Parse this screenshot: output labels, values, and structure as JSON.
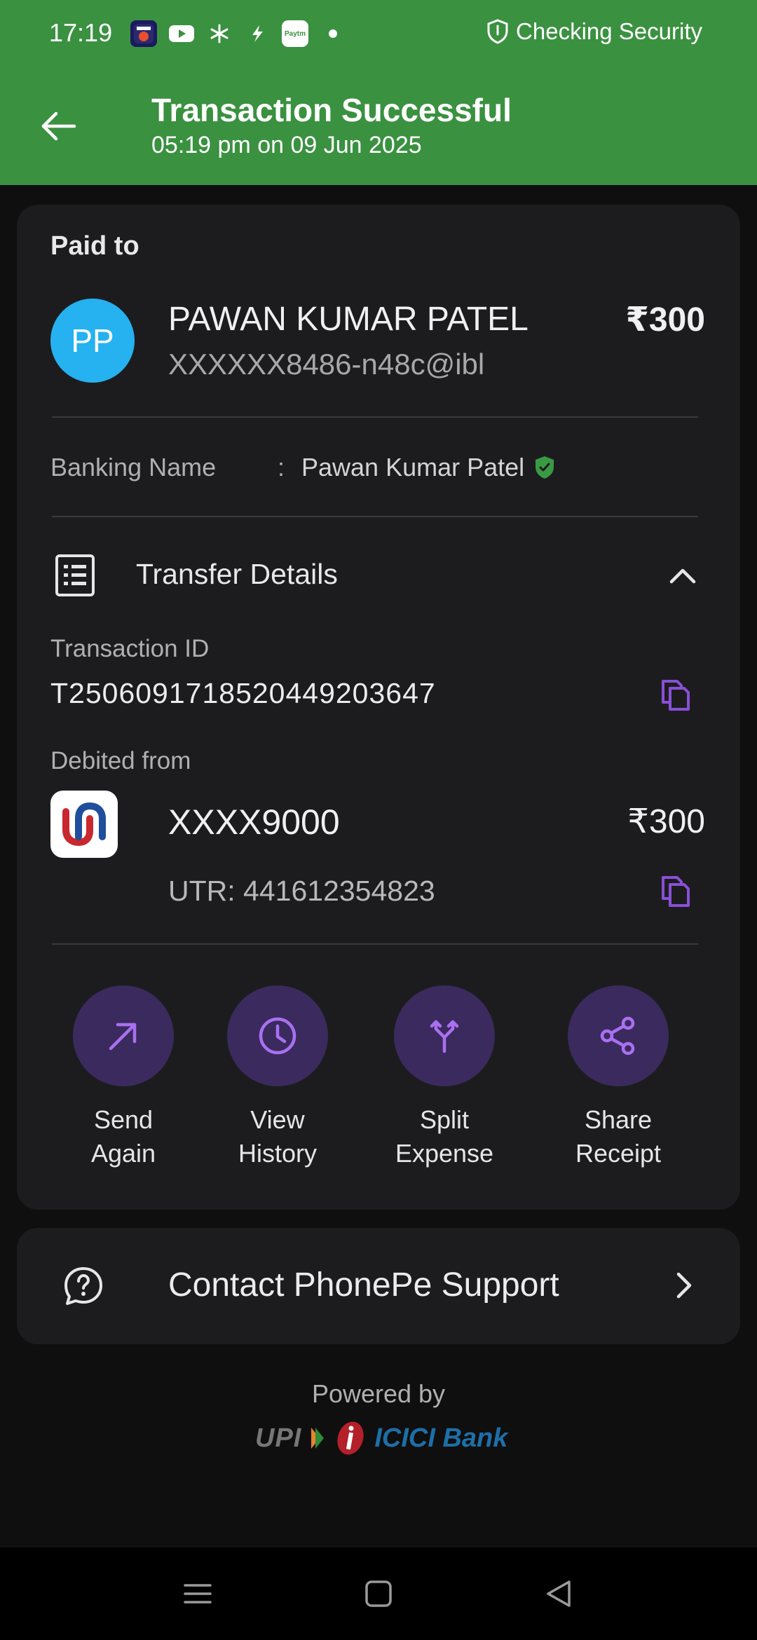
{
  "status_bar": {
    "time": "17:19",
    "security_text": "Checking Security",
    "icons": [
      "sonyliv-app-icon",
      "youtube-app-icon",
      "pinwheel-app-icon",
      "flash-app-icon",
      "paytm-app-icon",
      "dot-icon"
    ],
    "paytm_label": "Paytm"
  },
  "header": {
    "title": "Transaction Successful",
    "subtitle": "05:19 pm on 09 Jun 2025",
    "color": "#3a9140"
  },
  "payee": {
    "section_label": "Paid to",
    "initials": "PP",
    "name": "PAWAN KUMAR PATEL",
    "amount": "₹300",
    "upi_id": "XXXXXX8486-n48c@ibl"
  },
  "banking_name": {
    "label": "Banking Name",
    "colon": ":",
    "value": "Pawan Kumar Patel"
  },
  "transfer_details": {
    "title": "Transfer Details",
    "transaction_id_label": "Transaction ID",
    "transaction_id": "T2506091718520449203647",
    "debited_from_label": "Debited from",
    "account": "XXXX9000",
    "amount": "₹300",
    "utr": "UTR: 441612354823"
  },
  "actions": [
    {
      "label": "Send\nAgain",
      "icon": "arrow-up-right-icon"
    },
    {
      "label": "View\nHistory",
      "icon": "clock-icon"
    },
    {
      "label": "Split\nExpense",
      "icon": "split-icon"
    },
    {
      "label": "Share\nReceipt",
      "icon": "share-icon"
    }
  ],
  "support": {
    "label": "Contact PhonePe Support"
  },
  "footer": {
    "powered_by": "Powered by",
    "upi_logo": "UPI",
    "bank_logo": "ICICI Bank"
  },
  "colors": {
    "accent": "#8a4fd8",
    "action_bg": "#3b2a5e",
    "avatar": "#26b1f0",
    "verified": "#3a9a44"
  }
}
